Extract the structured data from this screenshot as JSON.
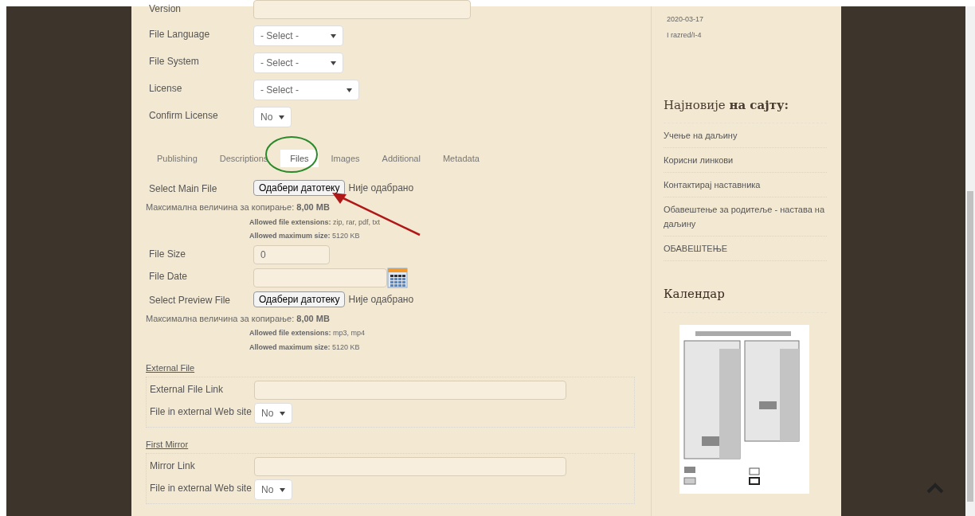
{
  "top_fields": [
    {
      "kind": "text",
      "label": "Version"
    },
    {
      "kind": "select",
      "label": "File Language",
      "value": "- Select -"
    },
    {
      "kind": "select",
      "label": "File System",
      "value": "- Select -"
    },
    {
      "kind": "select",
      "label": "License",
      "value": "- Select -"
    },
    {
      "kind": "select",
      "label": "Confirm License",
      "value": "No"
    }
  ],
  "tabs": [
    {
      "label": "Publishing",
      "selected": false
    },
    {
      "label": "Descriptions",
      "selected": false
    },
    {
      "label": "Files",
      "selected": true
    },
    {
      "label": "Images",
      "selected": false
    },
    {
      "label": "Additional",
      "selected": false
    },
    {
      "label": "Metadata",
      "selected": false
    }
  ],
  "files_fields": [
    {
      "kind": "file",
      "label": "Select Main File",
      "button": "Одабери датотеку",
      "status": "Није одабрано",
      "max_size": "Максимална величина за копирање: **8,00 MB**",
      "notes": [
        "**Allowed file extensions:** zip, rar, pdf, txt",
        "**Allowed maximum size:** 5120 KB"
      ]
    },
    {
      "kind": "text",
      "label": "File Size",
      "value": "0"
    },
    {
      "kind": "date",
      "label": "File Date"
    },
    {
      "kind": "file",
      "label": "Select Preview File",
      "button": "Одабери датотеку",
      "status": "Није одабрано",
      "max_size": "Максимална величина за копирање: **8,00 MB**",
      "notes": [
        "**Allowed file extensions:** mp3, mp4",
        "**Allowed maximum size:** 5120 KB"
      ]
    }
  ],
  "link_sections": [
    {
      "legend": "External File",
      "fields": [
        {
          "kind": "text",
          "label": "External File Link"
        },
        {
          "kind": "select",
          "label": "File in external Web site",
          "value": "No"
        }
      ]
    },
    {
      "legend": "First Mirror",
      "fields": [
        {
          "kind": "text",
          "label": "Mirror Link"
        },
        {
          "kind": "select",
          "label": "File in external Web site",
          "value": "No"
        }
      ]
    }
  ],
  "sidebar": {
    "meta": [
      "2020-03-17",
      "I razred/I-4"
    ],
    "latest": {
      "title": "Најновије **на сајту:**",
      "items": [
        "Учење на даљину",
        "Корисни линкови",
        "Контактирај наставника",
        "Обавештење за родитеље - настава на даљину",
        "ОБАВЕШТЕЊЕ"
      ]
    },
    "calendar": {
      "title": "Календар"
    }
  }
}
